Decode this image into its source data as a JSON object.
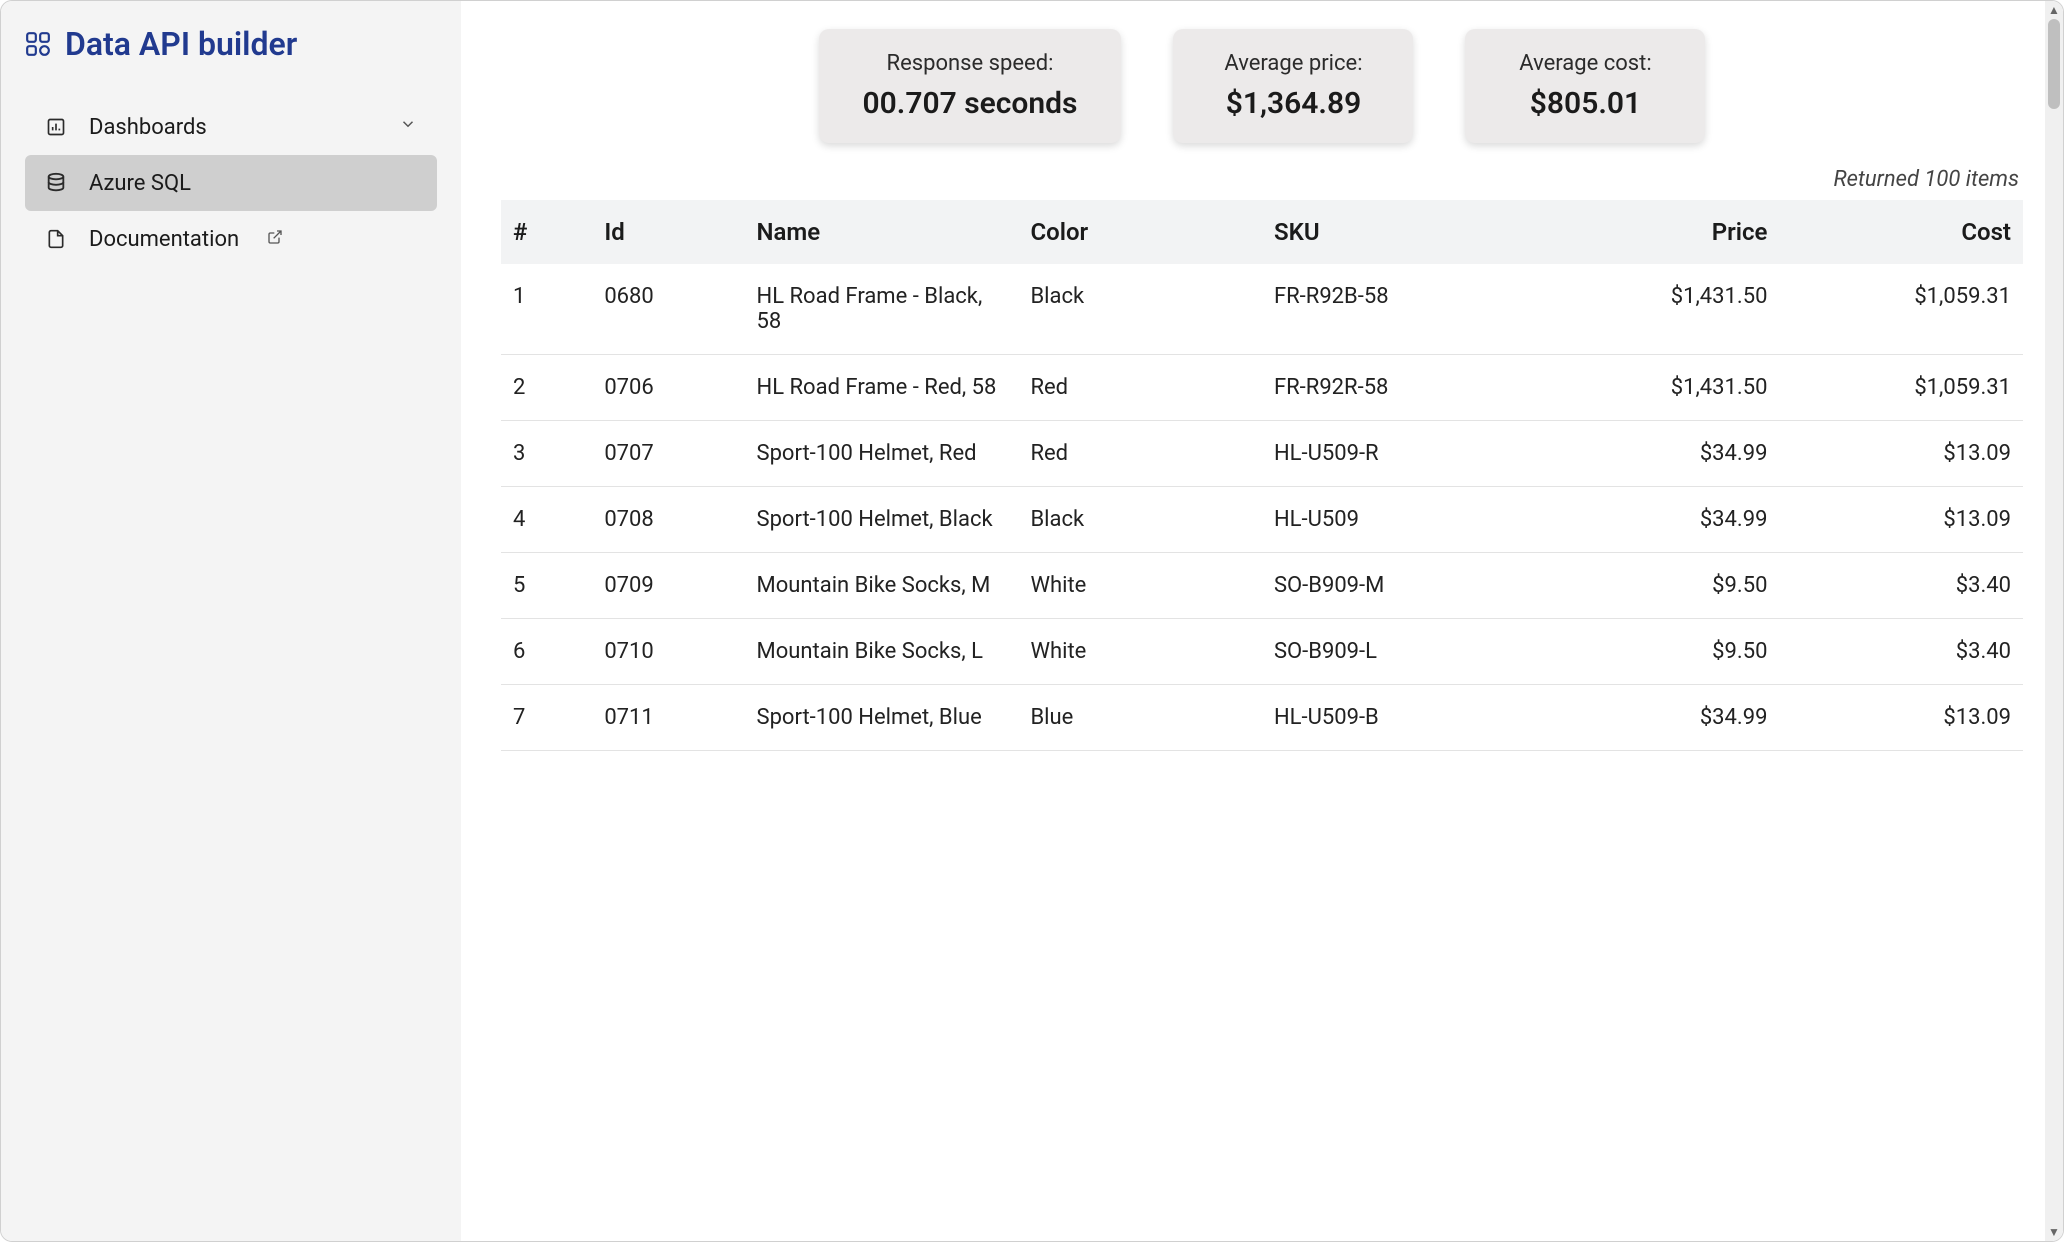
{
  "header": {
    "title": "Data API builder"
  },
  "sidebar": {
    "dashboards_label": "Dashboards",
    "azure_sql_label": "Azure SQL",
    "documentation_label": "Documentation"
  },
  "stats": {
    "response_label": "Response speed:",
    "response_value": "00.707 seconds",
    "avg_price_label": "Average price:",
    "avg_price_value": "$1,364.89",
    "avg_cost_label": "Average cost:",
    "avg_cost_value": "$805.01"
  },
  "table": {
    "returned_text": "Returned 100 items",
    "columns": {
      "idx": "#",
      "id": "Id",
      "name": "Name",
      "color": "Color",
      "sku": "SKU",
      "price": "Price",
      "cost": "Cost"
    },
    "rows": [
      {
        "idx": "1",
        "id": "0680",
        "name": "HL Road Frame - Black, 58",
        "color": "Black",
        "sku": "FR-R92B-58",
        "price": "$1,431.50",
        "cost": "$1,059.31"
      },
      {
        "idx": "2",
        "id": "0706",
        "name": "HL Road Frame - Red, 58",
        "color": "Red",
        "sku": "FR-R92R-58",
        "price": "$1,431.50",
        "cost": "$1,059.31"
      },
      {
        "idx": "3",
        "id": "0707",
        "name": "Sport-100 Helmet, Red",
        "color": "Red",
        "sku": "HL-U509-R",
        "price": "$34.99",
        "cost": "$13.09"
      },
      {
        "idx": "4",
        "id": "0708",
        "name": "Sport-100 Helmet, Black",
        "color": "Black",
        "sku": "HL-U509",
        "price": "$34.99",
        "cost": "$13.09"
      },
      {
        "idx": "5",
        "id": "0709",
        "name": "Mountain Bike Socks, M",
        "color": "White",
        "sku": "SO-B909-M",
        "price": "$9.50",
        "cost": "$3.40"
      },
      {
        "idx": "6",
        "id": "0710",
        "name": "Mountain Bike Socks, L",
        "color": "White",
        "sku": "SO-B909-L",
        "price": "$9.50",
        "cost": "$3.40"
      },
      {
        "idx": "7",
        "id": "0711",
        "name": "Sport-100 Helmet, Blue",
        "color": "Blue",
        "sku": "HL-U509-B",
        "price": "$34.99",
        "cost": "$13.09"
      }
    ]
  }
}
